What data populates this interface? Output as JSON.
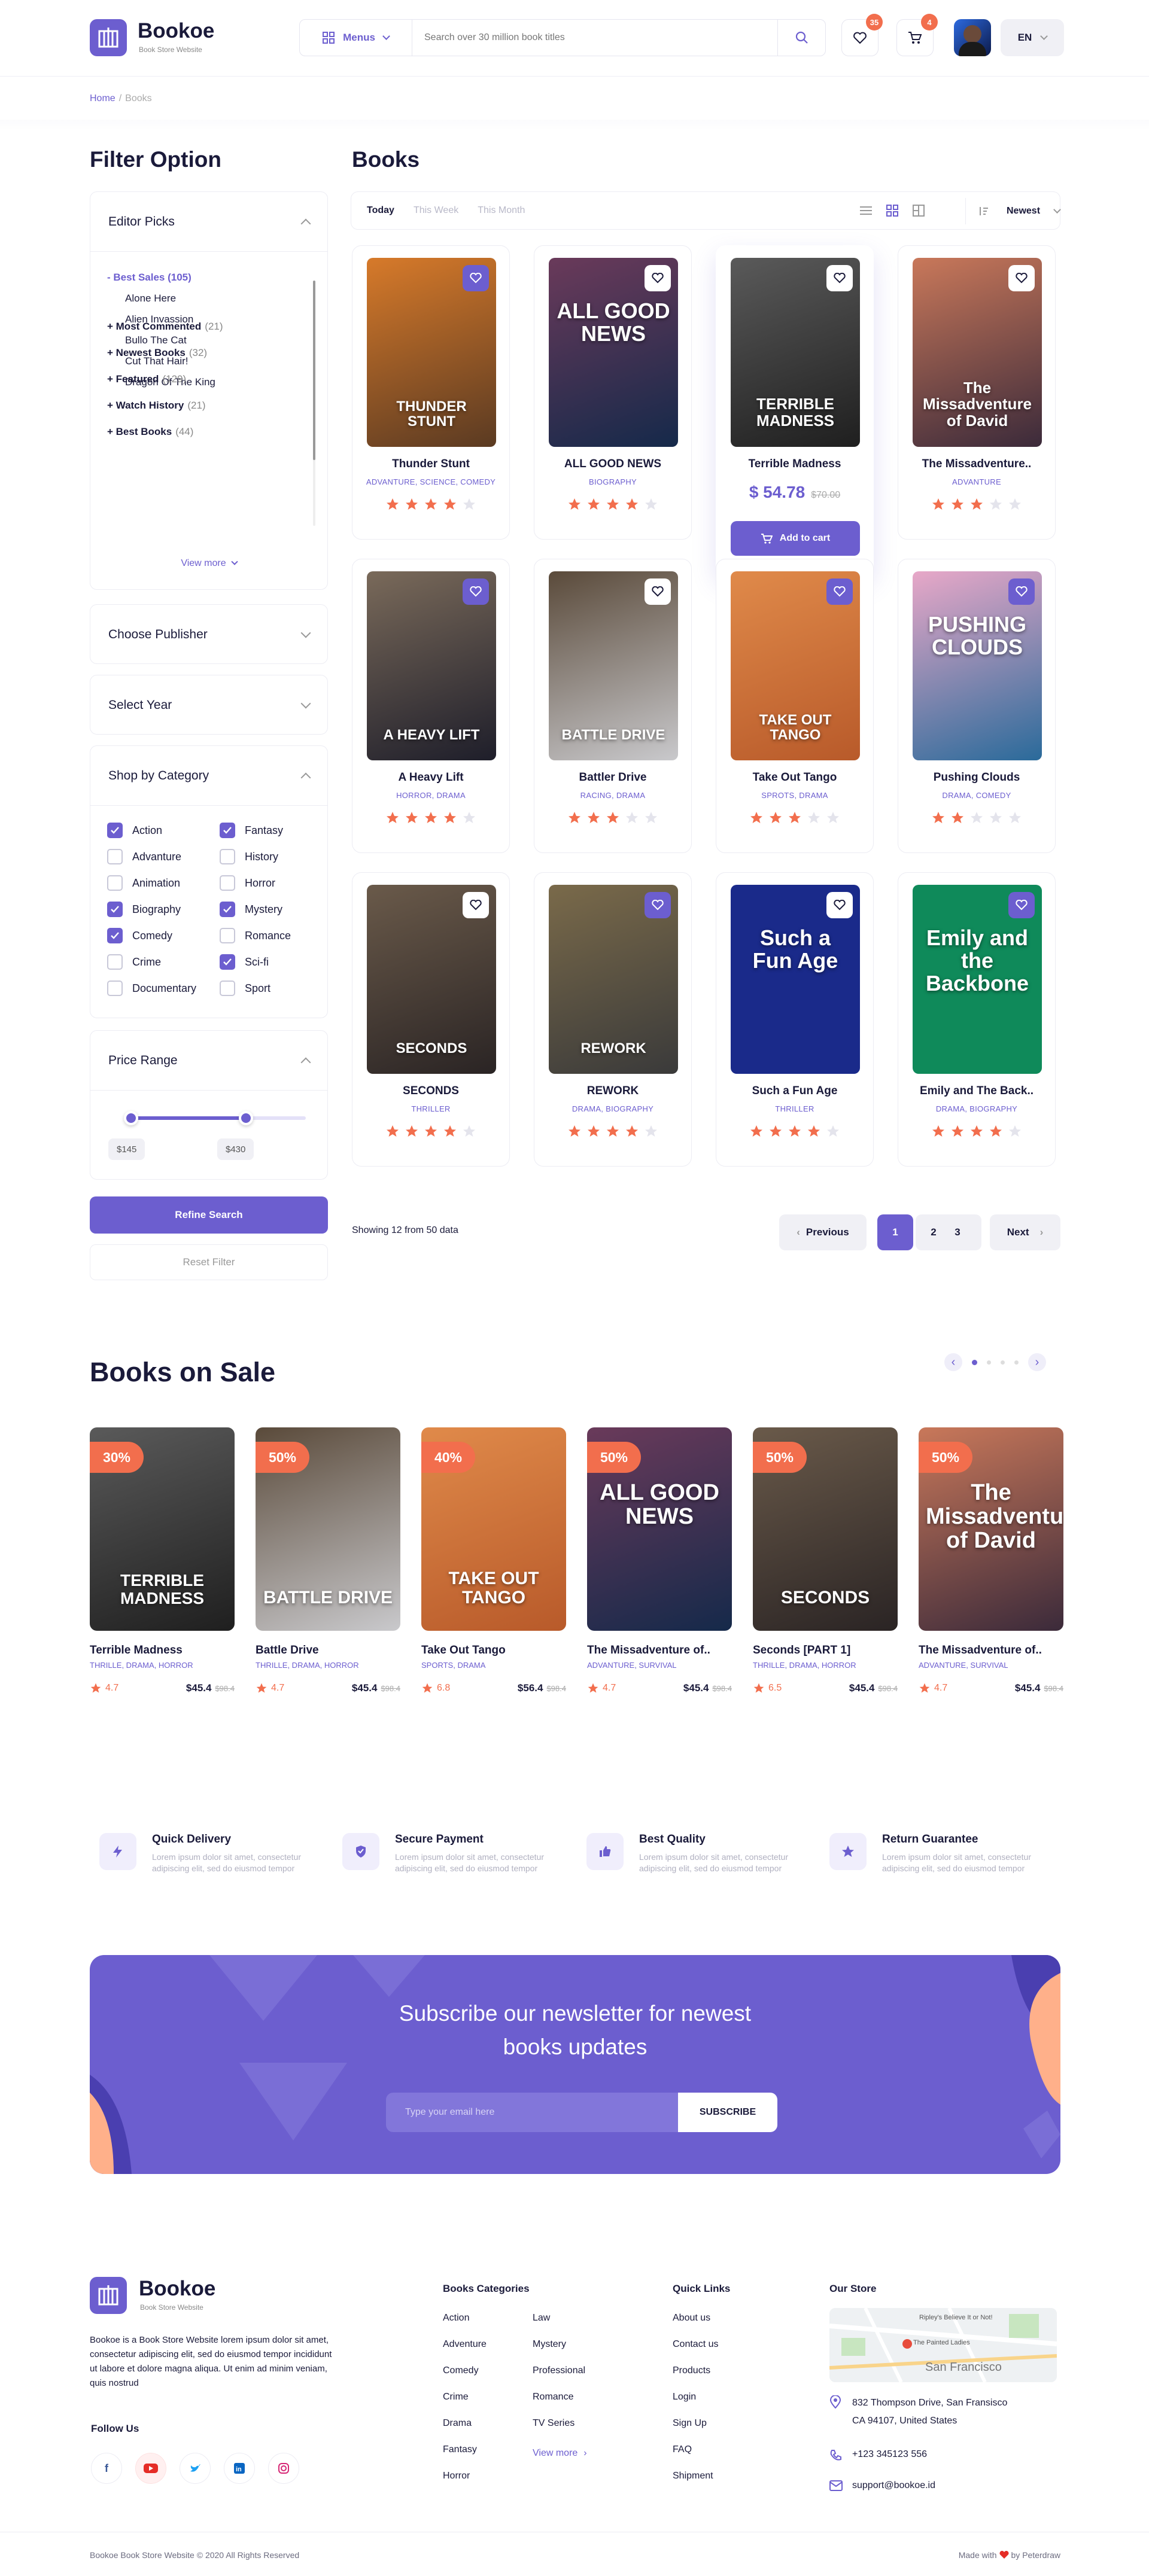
{
  "header": {
    "brand": "Bookoe",
    "brand_sub": "Book Store Website",
    "menus_label": "Menus",
    "search_placeholder": "Search over 30 million book titles",
    "wishlist_count": "35",
    "cart_count": "4",
    "language": "EN"
  },
  "breadcrumb": {
    "home": "Home",
    "current": "Books"
  },
  "filter": {
    "title": "Filter Option",
    "editor_picks": {
      "label": "Editor Picks",
      "open_group": "- Best Sales (105)",
      "sub_items": [
        "Alone Here",
        "Alien Invassion",
        "Bullo The Cat",
        "Cut That Hair!",
        "Dragon Of The King"
      ],
      "groups": [
        {
          "name": "+ Most Commented",
          "count": "(21)"
        },
        {
          "name": "+ Newest Books",
          "count": "(32)"
        },
        {
          "name": "+ Featured",
          "count": "(129)"
        },
        {
          "name": "+ Watch History",
          "count": "(21)"
        },
        {
          "name": "+ Best Books",
          "count": "(44)"
        }
      ],
      "view_more": "View more"
    },
    "publisher_label": "Choose Publisher",
    "year_label": "Select Year",
    "category": {
      "label": "Shop by Category",
      "items": [
        {
          "name": "Action",
          "checked": true
        },
        {
          "name": "Fantasy",
          "checked": true
        },
        {
          "name": "Advanture",
          "checked": false
        },
        {
          "name": "History",
          "checked": false
        },
        {
          "name": "Animation",
          "checked": false
        },
        {
          "name": "Horror",
          "checked": false
        },
        {
          "name": "Biography",
          "checked": true
        },
        {
          "name": "Mystery",
          "checked": true
        },
        {
          "name": "Comedy",
          "checked": true
        },
        {
          "name": "Romance",
          "checked": false
        },
        {
          "name": "Crime",
          "checked": false
        },
        {
          "name": "Sci-fi",
          "checked": true
        },
        {
          "name": "Documentary",
          "checked": false
        },
        {
          "name": "Sport",
          "checked": false
        }
      ]
    },
    "price": {
      "label": "Price Range",
      "min": "$145",
      "max": "$430"
    },
    "refine_label": "Refine Search",
    "reset_label": "Reset Filter"
  },
  "books_section": {
    "title": "Books",
    "tabs": [
      "Today",
      "This Week",
      "This Month"
    ],
    "sort_label": "Newest",
    "showing": "Showing 12 from 50 data",
    "pager": {
      "prev": "Previous",
      "pages": [
        "1",
        "2",
        "3"
      ],
      "next": "Next"
    }
  },
  "books": [
    {
      "title": "Thunder Stunt",
      "genre": "ADVANTURE, SCIENCE, COMEDY",
      "cover_text": "THUNDER STUNT",
      "rating": 4,
      "liked": true,
      "bg": "#5a3a22",
      "bg2": "#d77a2a"
    },
    {
      "title": "ALL GOOD NEWS",
      "genre": "BIOGRAPHY",
      "cover_text": "ALL GOOD NEWS",
      "rating": 4,
      "liked": false,
      "bg": "#15294a",
      "bg2": "#6a3a5a"
    },
    {
      "title": "Terrible Madness",
      "genre": "",
      "cover_text": "TERRIBLE MADNESS",
      "rating": 0,
      "liked": false,
      "bg": "#1f1f1f",
      "bg2": "#5a5a5a",
      "price": "$ 54.78",
      "old_price": "$70.00",
      "cart": "Add to cart"
    },
    {
      "title": "The Missadventure..",
      "genre": "ADVANTURE",
      "cover_text": "The Missadventure of David",
      "rating": 3,
      "liked": false,
      "bg": "#3b2a3a",
      "bg2": "#c9785a"
    },
    {
      "title": "A Heavy Lift",
      "genre": "HORROR, DRAMA",
      "cover_text": "A HEAVY LIFT",
      "rating": 4,
      "liked": true,
      "bg": "#1e1e2a",
      "bg2": "#7a6a5a"
    },
    {
      "title": "Battler Drive",
      "genre": "RACING, DRAMA",
      "cover_text": "BATTLE DRIVE",
      "rating": 3,
      "liked": false,
      "bg": "#c9c9cc",
      "bg2": "#5a4a3a"
    },
    {
      "title": "Take Out Tango",
      "genre": "SPROTS, DRAMA",
      "cover_text": "TAKE OUT TANGO",
      "rating": 3,
      "liked": true,
      "bg": "#b85a2a",
      "bg2": "#e08a4a"
    },
    {
      "title": "Pushing Clouds",
      "genre": "DRAMA, COMEDY",
      "cover_text": "PUSHING CLOUDS",
      "rating": 2,
      "liked": true,
      "bg": "#2a6a9a",
      "bg2": "#e8a8c8"
    },
    {
      "title": "SECONDS",
      "genre": "THRILLER",
      "cover_text": "SECONDS",
      "rating": 4,
      "liked": false,
      "bg": "#2a2424",
      "bg2": "#6a5a4a"
    },
    {
      "title": "REWORK",
      "genre": "DRAMA, BIOGRAPHY",
      "cover_text": "REWORK",
      "rating": 4,
      "liked": true,
      "bg": "#3a3a3a",
      "bg2": "#7a6a4a"
    },
    {
      "title": "Such a Fun Age",
      "genre": "THRILLER",
      "cover_text": "Such a Fun Age",
      "rating": 4,
      "liked": false,
      "bg": "#1a2a8a",
      "bg2": "#1a2a8a"
    },
    {
      "title": "Emily and The Back..",
      "genre": "DRAMA, BIOGRAPHY",
      "cover_text": "Emily and the Backbone",
      "rating": 4,
      "liked": true,
      "bg": "#0f8a5a",
      "bg2": "#0f8a5a"
    }
  ],
  "sale": {
    "title": "Books on Sale",
    "items": [
      {
        "title": "Terrible Madness",
        "genre": "THRILLE, DRAMA, HORROR",
        "discount": "30%",
        "rating": "4.7",
        "price": "$45.4",
        "old": "$98.4",
        "cover_text": "TERRIBLE MADNESS",
        "bg": "#1f1f1f",
        "bg2": "#5a5a5a"
      },
      {
        "title": "Battle Drive",
        "genre": "THRILLE, DRAMA, HORROR",
        "discount": "50%",
        "rating": "4.7",
        "price": "$45.4",
        "old": "$98.4",
        "cover_text": "BATTLE DRIVE",
        "bg": "#c9c9cc",
        "bg2": "#5a4a3a"
      },
      {
        "title": "Take Out Tango",
        "genre": "SPORTS, DRAMA",
        "discount": "40%",
        "rating": "6.8",
        "price": "$56.4",
        "old": "$98.4",
        "cover_text": "TAKE OUT TANGO",
        "bg": "#b85a2a",
        "bg2": "#e08a4a"
      },
      {
        "title": "The Missadventure of..",
        "genre": "ADVANTURE, SURVIVAL",
        "discount": "50%",
        "rating": "4.7",
        "price": "$45.4",
        "old": "$98.4",
        "cover_text": "ALL GOOD NEWS",
        "bg": "#15294a",
        "bg2": "#6a3a5a"
      },
      {
        "title": "Seconds [PART 1]",
        "genre": "THRILLE, DRAMA, HORROR",
        "discount": "50%",
        "rating": "6.5",
        "price": "$45.4",
        "old": "$98.4",
        "cover_text": "SECONDS",
        "bg": "#2a2424",
        "bg2": "#6a5a4a"
      },
      {
        "title": "The Missadventure of..",
        "genre": "ADVANTURE, SURVIVAL",
        "discount": "50%",
        "rating": "4.7",
        "price": "$45.4",
        "old": "$98.4",
        "cover_text": "The Missadventure of David",
        "bg": "#3b2a3a",
        "bg2": "#c9785a"
      }
    ]
  },
  "features": [
    {
      "title": "Quick Delivery",
      "desc": "Lorem ipsum dolor sit amet, consectetur adipiscing elit, sed do eiusmod tempor",
      "icon": "bolt-icon"
    },
    {
      "title": "Secure Payment",
      "desc": "Lorem ipsum dolor sit amet, consectetur adipiscing elit, sed do eiusmod tempor",
      "icon": "shield-icon"
    },
    {
      "title": "Best Quality",
      "desc": "Lorem ipsum dolor sit amet, consectetur adipiscing elit, sed do eiusmod tempor",
      "icon": "thumbs-up-icon"
    },
    {
      "title": "Return Guarantee",
      "desc": "Lorem ipsum dolor sit amet, consectetur adipiscing elit, sed do eiusmod tempor",
      "icon": "star-icon"
    }
  ],
  "newsletter": {
    "title_line1": "Subscribe our newsletter for newest",
    "title_line2": "books updates",
    "placeholder": "Type your email here",
    "button": "SUBSCRIBE"
  },
  "footer": {
    "brand": "Bookoe",
    "brand_sub": "Book Store Website",
    "about": "Bookoe is a Book Store Website lorem ipsum dolor sit amet, consectetur adipiscing elit, sed do eiusmod tempor incididunt ut labore et dolore magna aliqua. Ut enim ad minim veniam, quis nostrud",
    "follow": "Follow Us",
    "categories_title": "Books Categories",
    "categories_col1": [
      "Action",
      "Adventure",
      "Comedy",
      "Crime",
      "Drama",
      "Fantasy",
      "Horror"
    ],
    "categories_col2": [
      "Law",
      "Mystery",
      "Professional",
      "Romance",
      "TV Series"
    ],
    "view_more": "View more",
    "links_title": "Quick Links",
    "links": [
      "About us",
      "Contact us",
      "Products",
      "Login",
      "Sign Up",
      "FAQ",
      "Shipment"
    ],
    "store_title": "Our Store",
    "map_label1": "Ripley's Believe It or Not!",
    "map_label2": "The Painted Ladies",
    "map_label3": "San Francisco",
    "address_line1": "832  Thompson Drive, San Fransisco",
    "address_line2": "CA 94107, United States",
    "phone": "+123 345123 556",
    "email": "support@bookoe.id",
    "copyright": "Bookoe Book Store Website  © 2020 All Rights Reserved",
    "made_with": "Made with",
    "by": "by Peterdraw"
  },
  "colors": {
    "accent": "#6c5ecf",
    "orange": "#f26e4d",
    "star": "#f26e4d"
  }
}
